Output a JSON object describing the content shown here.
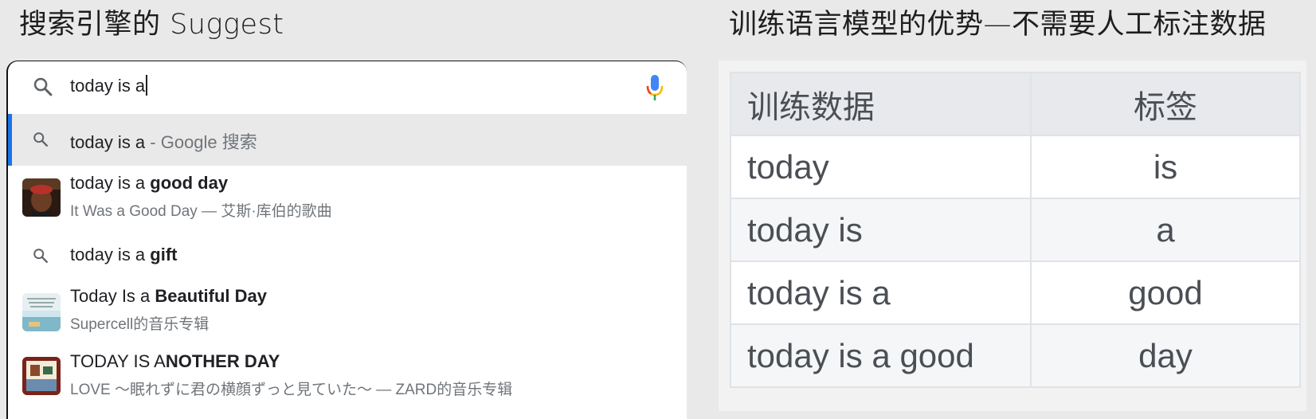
{
  "headings": {
    "left": "搜索引擎的 Suggest",
    "right": "训练语言模型的优势—不需要人工标注数据"
  },
  "search": {
    "query": "today is a"
  },
  "suggestions": [
    {
      "prefix": "today is a",
      "suffix": " - Google 搜索",
      "icon": "search-icon"
    },
    {
      "prefix": "today is a ",
      "bold": "good day",
      "sub": "It Was a Good Day — 艾斯·库伯的歌曲",
      "icon": "song-thumbnail"
    },
    {
      "prefix": "today is a ",
      "bold": "gift",
      "icon": "search-icon"
    },
    {
      "prefix": "Today Is a ",
      "bold": "Beautiful Day",
      "sub": "Supercell的音乐专辑",
      "icon": "album-thumbnail"
    },
    {
      "prefix": "TODAY IS A",
      "bold": "NOTHER DAY",
      "sub": "LOVE ～眠れずに君の横顔ずっと見ていた～ — ZARD的音乐专辑",
      "icon": "album-thumbnail"
    }
  ],
  "table": {
    "headers": [
      "训练数据",
      "标签"
    ],
    "rows": [
      [
        "today",
        "is"
      ],
      [
        "today is",
        "a"
      ],
      [
        "today is a",
        "good"
      ],
      [
        "today is a good",
        "day"
      ]
    ]
  },
  "colors": {
    "accent": "#1a73e8",
    "mic_blue": "#4285f4",
    "mic_red": "#ea4335",
    "mic_yellow": "#fbbc04",
    "mic_green": "#34a853"
  }
}
